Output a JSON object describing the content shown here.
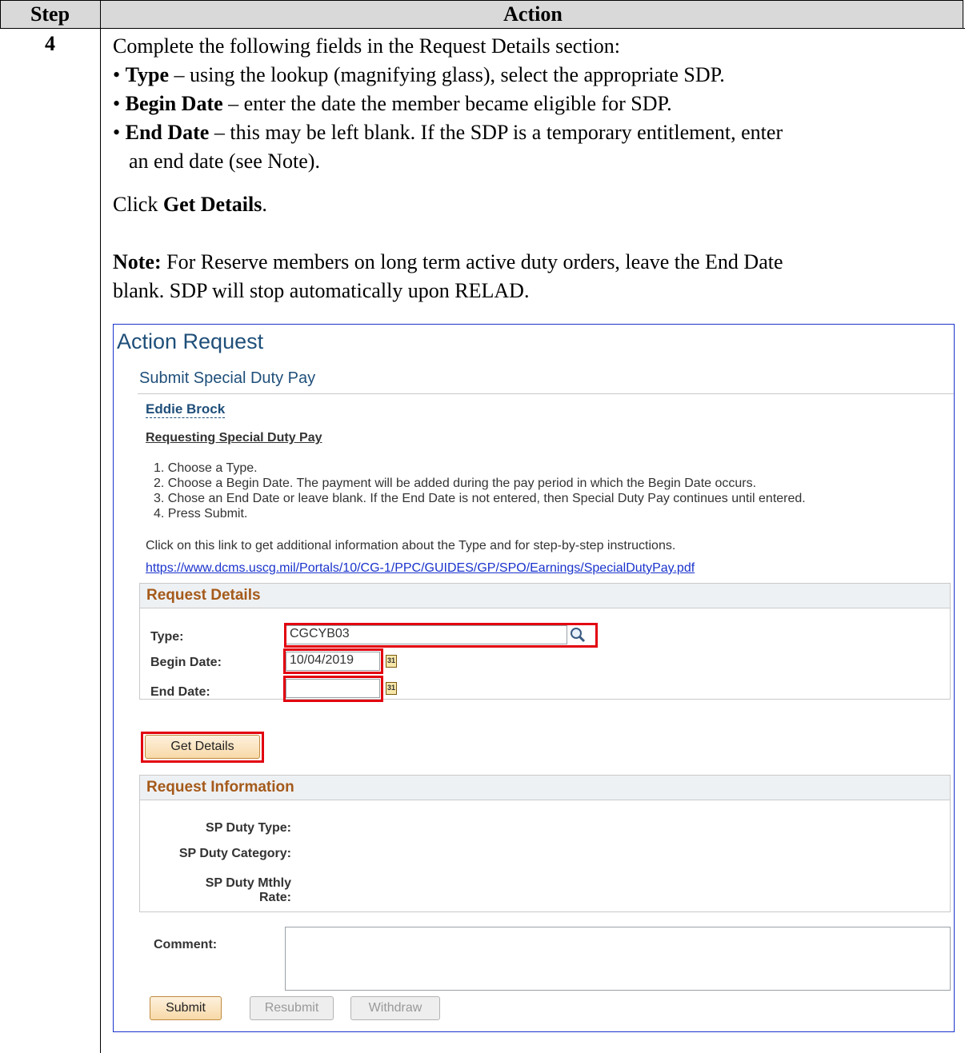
{
  "table": {
    "header_step": "Step",
    "header_action": "Action",
    "step_number": "4"
  },
  "instructions": {
    "intro": "Complete the following fields in the Request Details section:",
    "bullet1_term": "Type",
    "bullet1_text": " – using the lookup (magnifying glass), select the appropriate SDP.",
    "bullet2_term": "Begin Date",
    "bullet2_text": " – enter the date the member became eligible for SDP.",
    "bullet3_term": "End Date",
    "bullet3_text": " – this may be left blank.  If the SDP is a temporary entitlement, enter",
    "bullet3_cont": "an end date (see Note).",
    "click_pre": "Click ",
    "click_term": "Get Details",
    "click_post": ".",
    "note_term": "Note:",
    "note_text": "  For Reserve members on long term active duty orders, leave the End Date",
    "note_cont": "blank.  SDP will stop automatically upon RELAD."
  },
  "screen": {
    "title": "Action Request",
    "subtitle": "Submit Special Duty Pay",
    "member_name": "Eddie Brock",
    "section_heading": "Requesting Special Duty Pay",
    "steps": [
      "1.  Choose a Type.",
      "2.  Choose a Begin Date. The payment will be added during the pay period in which the Begin Date occurs.",
      "3.  Chose an End Date or leave blank. If the End Date is not entered, then Special Duty Pay continues until entered.",
      "4.  Press Submit."
    ],
    "click_info": "Click on this link to get additional information about the Type and for step-by-step instructions.",
    "link": "https://www.dcms.uscg.mil/Portals/10/CG-1/PPC/GUIDES/GP/SPO/Earnings/SpecialDutyPay.pdf",
    "request_details": {
      "heading": "Request Details",
      "type_label": "Type:",
      "type_value": "CGCYB03",
      "begin_label": "Begin Date:",
      "begin_value": "10/04/2019",
      "end_label": "End Date:",
      "end_value": "",
      "calendar_glyph": "31"
    },
    "get_details": "Get Details",
    "request_information": {
      "heading": "Request Information",
      "duty_type_label": "SP Duty Type:",
      "duty_category_label": "SP Duty Category:",
      "mthly_label_line1": "SP Duty Mthly",
      "mthly_label_line2": "Rate:"
    },
    "comment_label": "Comment:",
    "buttons": {
      "submit": "Submit",
      "resubmit": "Resubmit",
      "withdraw": "Withdraw"
    },
    "colors": {
      "highlight": "#e2000f",
      "frame": "#1a33cc",
      "title": "#1f4f7a",
      "section_heading": "#a55a1a"
    }
  }
}
